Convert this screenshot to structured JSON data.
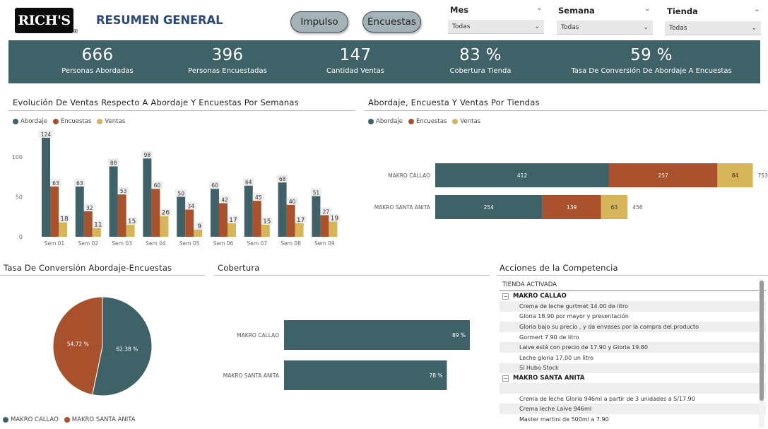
{
  "header": {
    "logo_text": "RICH'S",
    "logo_reg": "®",
    "title": "RESUMEN GENERAL",
    "buttons": {
      "impulso": "Impulso",
      "encuestas": "Encuestas"
    }
  },
  "filters": [
    {
      "label": "Mes",
      "value": "Todas"
    },
    {
      "label": "Semana",
      "value": "Todas"
    },
    {
      "label": "Tienda",
      "value": "Todas"
    }
  ],
  "kpis": [
    {
      "value": "666",
      "label": "Personas Abordadas"
    },
    {
      "value": "396",
      "label": "Personas Encuestadas"
    },
    {
      "value": "147",
      "label": "Cantidad Ventas"
    },
    {
      "value": "83 %",
      "label": "Cobertura Tienda"
    },
    {
      "value": "59 %",
      "label": "Tasa De Conversión De Abordaje A Encuestas"
    }
  ],
  "colors": {
    "abordaje": "#3f6269",
    "encuestas": "#a9512d",
    "ventas": "#d6b55a",
    "kpi_band": "#3f6269",
    "title": "#2e4a7a"
  },
  "sections": {
    "weekly_title": "Evolución De Ventas Respecto A Abordaje Y Encuestas Por Semanas",
    "store_title": "Abordaje, Encuesta Y Ventas Por Tiendas",
    "conversion_title": "Tasa De Conversión Abordaje-Encuestas",
    "coverage_title": "Cobertura",
    "competition_title": "Acciones de la Competencia"
  },
  "chart_data": [
    {
      "type": "bar",
      "title": "Evolución De Ventas Respecto A Abordaje Y Encuestas Por Semanas",
      "categories": [
        "Sem 01",
        "Sem 02",
        "Sem 03",
        "Sem 04",
        "Sem 05",
        "Sem 06",
        "Sem 07",
        "Sem 08",
        "Sem 09"
      ],
      "series": [
        {
          "name": "Abordaje",
          "values": [
            124,
            63,
            88,
            98,
            50,
            60,
            64,
            68,
            51
          ]
        },
        {
          "name": "Encuestas",
          "values": [
            63,
            32,
            53,
            60,
            34,
            42,
            45,
            40,
            27
          ]
        },
        {
          "name": "Ventas",
          "values": [
            18,
            11,
            15,
            26,
            9,
            17,
            15,
            17,
            19
          ]
        }
      ],
      "yticks": [
        "0",
        "50",
        "100"
      ],
      "ylim": [
        0,
        130
      ],
      "legend": "top-left",
      "grid": false
    },
    {
      "type": "bar",
      "orientation": "horizontal-stacked",
      "title": "Abordaje, Encuesta Y Ventas Por Tiendas",
      "categories": [
        "MAKRO CALLAO",
        "MAKRO SANTA ANITA"
      ],
      "series": [
        {
          "name": "Abordaje",
          "values": [
            412,
            254
          ]
        },
        {
          "name": "Encuestas",
          "values": [
            257,
            139
          ]
        },
        {
          "name": "Ventas",
          "values": [
            84,
            63
          ]
        }
      ],
      "totals": [
        "753",
        "456"
      ],
      "legend": "top-left"
    },
    {
      "type": "pie",
      "title": "Tasa De Conversión Abordaje-Encuestas",
      "slices": [
        {
          "name": "MAKRO CALLAO",
          "value": 62.38,
          "label": "62.38 %"
        },
        {
          "name": "MAKRO SANTA ANITA",
          "value": 54.72,
          "label": "54.72 %"
        }
      ],
      "legend": "bottom-left"
    },
    {
      "type": "bar",
      "orientation": "horizontal",
      "title": "Cobertura",
      "categories": [
        "MAKRO CALLAO",
        "MAKRO SANTA ANITA"
      ],
      "values": [
        89,
        78
      ],
      "labels": [
        "89 %",
        "78 %"
      ],
      "xlim": [
        0,
        100
      ]
    }
  ],
  "competition_table": {
    "header": "TIENDA ACTIVADA",
    "groups": [
      {
        "name": "MAKRO CALLAO",
        "rows": [
          "Crema de leche gurtmet 14.00 de litro",
          "Gloria 18.90 por mayor y presentación",
          "Gloria bajo su precio , y da envases por la compra del.producto",
          "Gormert 7.90 de litro",
          "Laive está con precio de 17.90 y Gloria 19.80",
          "Leche gloria 17.00 un litro",
          "Sí Hubo Stock"
        ]
      },
      {
        "name": "MAKRO SANTA ANITA",
        "rows": [
          "",
          "Crema de leche Gloria 946ml a partir de 3 unidades a S/17.90",
          "Crema leche Laive 946ml",
          "Master martini de 500ml a 7.90"
        ]
      }
    ]
  }
}
